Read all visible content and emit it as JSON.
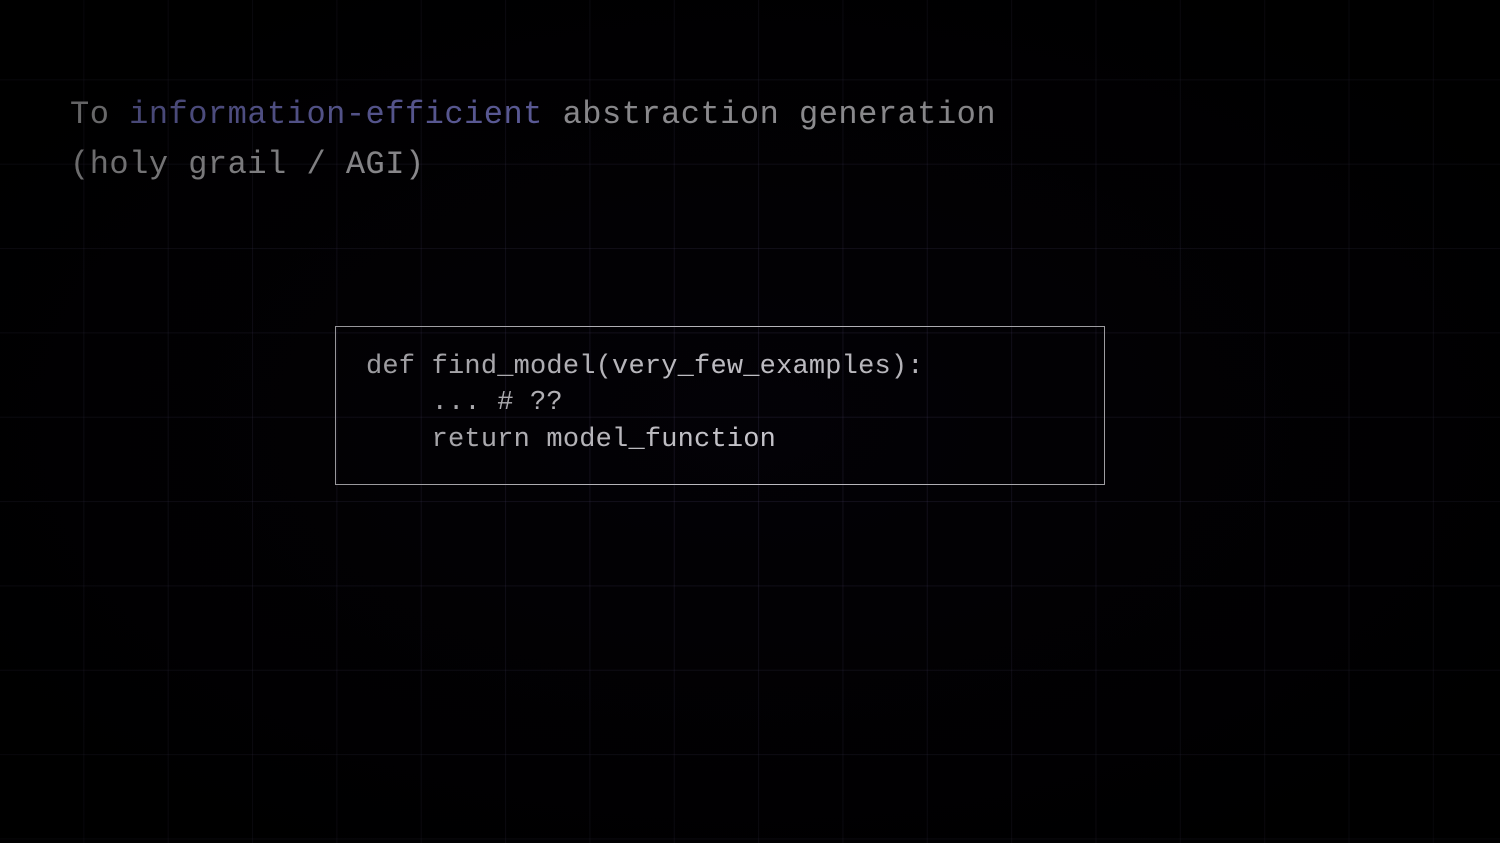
{
  "heading": {
    "pre": "To ",
    "emphasis": "information-efficient",
    "post": " abstraction generation",
    "line2": "(holy grail / AGI)"
  },
  "code": {
    "line1": "def find_model(very_few_examples):",
    "line2": "    ... # ??",
    "line3": "    return model_function"
  }
}
